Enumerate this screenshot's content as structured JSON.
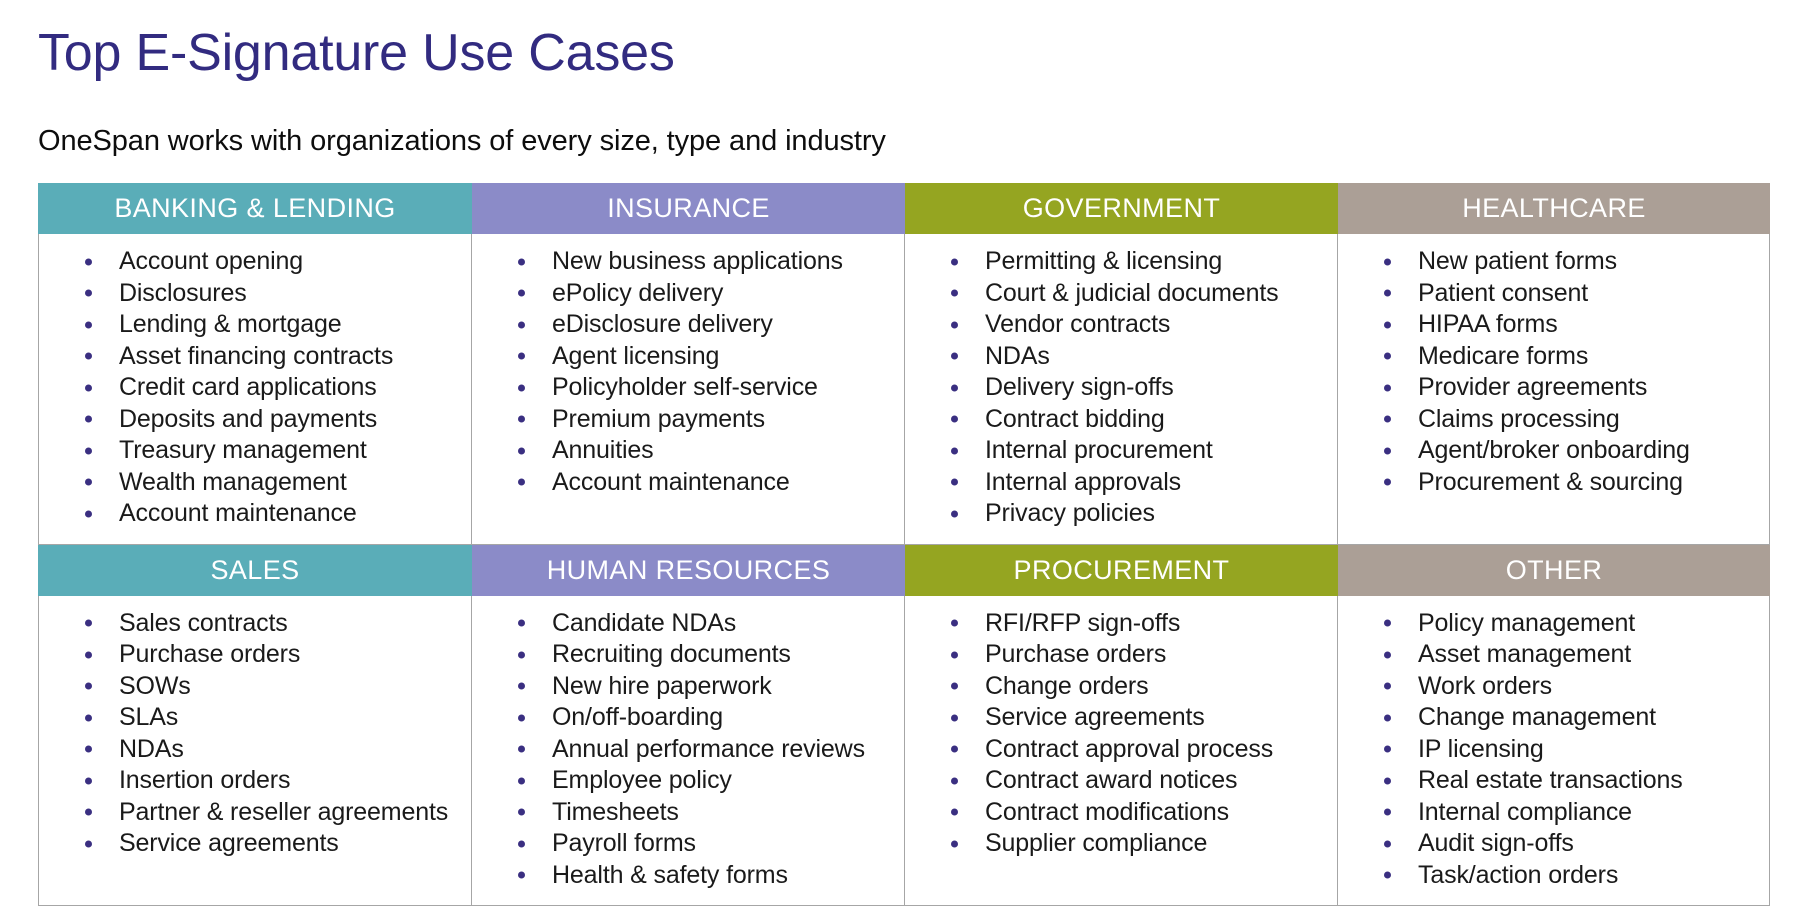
{
  "page": {
    "title": "Top E-Signature Use Cases",
    "subtitle": "OneSpan works with organizations of every size, type and industry",
    "title_color": "#322b80",
    "bullet_color": "#3a2f81",
    "border_color": "#a6a6a6"
  },
  "palette": {
    "teal": "#5aadb8",
    "purple": "#8b8bc8",
    "olive": "#95a521",
    "taupe": "#ab9f96"
  },
  "categories": [
    {
      "header": "BANKING & LENDING",
      "color": "#5aadb8",
      "items": [
        "Account opening",
        "Disclosures",
        "Lending & mortgage",
        "Asset financing contracts",
        "Credit card applications",
        "Deposits and payments",
        "Treasury management",
        "Wealth management",
        "Account maintenance"
      ]
    },
    {
      "header": "INSURANCE",
      "color": "#8b8bc8",
      "items": [
        "New business applications",
        "ePolicy delivery",
        "eDisclosure delivery",
        "Agent licensing",
        "Policyholder self-service",
        "Premium payments",
        "Annuities",
        "Account maintenance"
      ]
    },
    {
      "header": "GOVERNMENT",
      "color": "#95a521",
      "items": [
        "Permitting & licensing",
        "Court & judicial documents",
        "Vendor contracts",
        "NDAs",
        "Delivery sign-offs",
        "Contract bidding",
        "Internal procurement",
        "Internal approvals",
        "Privacy policies"
      ]
    },
    {
      "header": "HEALTHCARE",
      "color": "#ab9f96",
      "items": [
        "New patient forms",
        "Patient consent",
        "HIPAA forms",
        "Medicare forms",
        "Provider agreements",
        "Claims processing",
        "Agent/broker onboarding",
        "Procurement & sourcing"
      ]
    },
    {
      "header": "SALES",
      "color": "#5aadb8",
      "items": [
        "Sales contracts",
        "Purchase orders",
        "SOWs",
        "SLAs",
        "NDAs",
        "Insertion orders",
        "Partner & reseller agreements",
        "Service agreements"
      ]
    },
    {
      "header": "HUMAN RESOURCES",
      "color": "#8b8bc8",
      "items": [
        "Candidate NDAs",
        "Recruiting documents",
        "New hire paperwork",
        "On/off-boarding",
        "Annual performance reviews",
        "Employee policy",
        "Timesheets",
        "Payroll forms",
        "Health & safety forms"
      ]
    },
    {
      "header": "PROCUREMENT",
      "color": "#95a521",
      "items": [
        "RFI/RFP sign-offs",
        "Purchase orders",
        "Change orders",
        "Service agreements",
        "Contract approval process",
        "Contract award notices",
        "Contract modifications",
        "Supplier compliance"
      ]
    },
    {
      "header": "OTHER",
      "color": "#ab9f96",
      "items": [
        "Policy management",
        "Asset management",
        "Work orders",
        "Change management",
        "IP licensing",
        "Real estate transactions",
        "Internal compliance",
        "Audit sign-offs",
        "Task/action orders"
      ]
    }
  ]
}
